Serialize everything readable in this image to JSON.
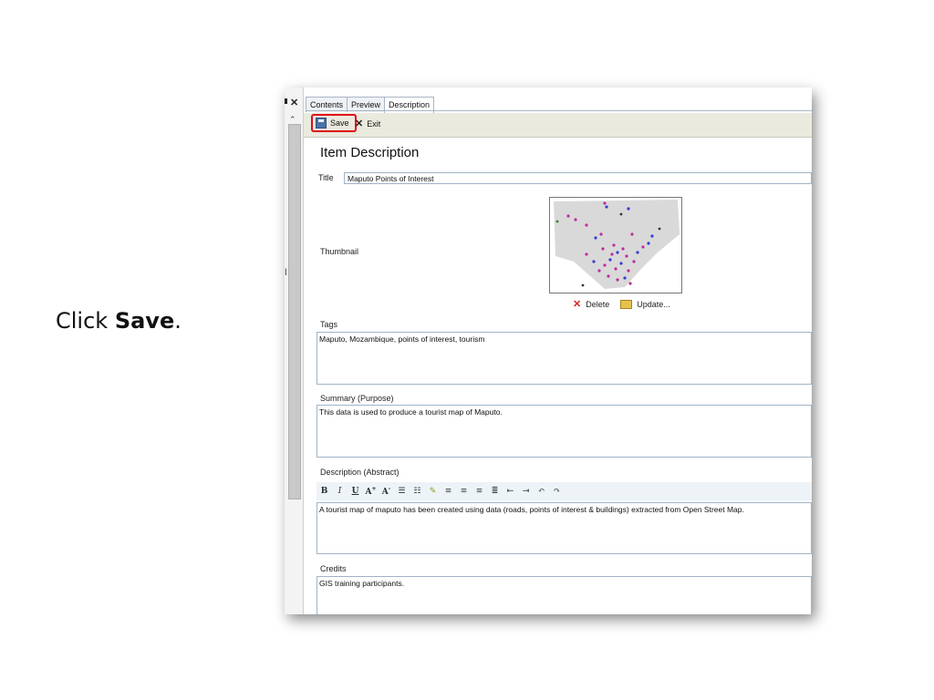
{
  "instruction": {
    "prefix": "Click ",
    "bold": "Save",
    "suffix": "."
  },
  "tabs": [
    "Contents",
    "Preview",
    "Description"
  ],
  "toolbar": {
    "save_label": "Save",
    "exit_label": "Exit"
  },
  "form": {
    "heading": "Item Description",
    "title_label": "Title",
    "title_value": "Maputo Points of Interest",
    "thumbnail_label": "Thumbnail",
    "delete_label": "Delete",
    "update_label": "Update...",
    "tags_label": "Tags",
    "tags_value": "Maputo, Mozambique, points of interest, tourism",
    "summary_label": "Summary (Purpose)",
    "summary_value": "This data is used to produce a tourist map of Maputo.",
    "description_label": "Description (Abstract)",
    "description_value": "A tourist map of maputo has been created using data (roads, points of interest & buildings) extracted from Open Street Map.",
    "credits_label": "Credits",
    "credits_value": "GIS training participants."
  },
  "richtext": {
    "bold": "B",
    "italic": "I",
    "underline": "U"
  },
  "colors": {
    "highlight": "#e0101a",
    "toolbar_bg": "#ebeadf",
    "field_border": "#9fb3c8"
  }
}
